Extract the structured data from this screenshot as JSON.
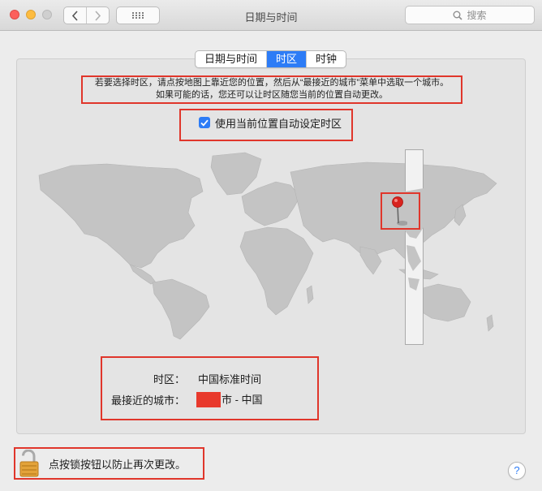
{
  "window": {
    "title": "日期与时间",
    "search_placeholder": "搜索"
  },
  "tabs": [
    {
      "label": "日期与时间",
      "active": false
    },
    {
      "label": "时区",
      "active": true
    },
    {
      "label": "时钟",
      "active": false
    }
  ],
  "instruction": {
    "line1": "若要选择时区，请点按地图上靠近您的位置，然后从“最接近的城市”菜单中选取一个城市。",
    "line2": "如果可能的话，您还可以让时区随您当前的位置自动更改。"
  },
  "auto_timezone": {
    "label": "使用当前位置自动设定时区",
    "checked": true
  },
  "timezone_info": {
    "timezone_label": "时区：",
    "timezone_value": "中国标准时间",
    "city_label": "最接近的城市：",
    "city_value": "市 - 中国"
  },
  "lock": {
    "label": "点按锁按钮以防止再次更改。"
  },
  "help_label": "?",
  "colors": {
    "accent": "#2d7cf6",
    "highlight_box": "#e0362b",
    "land": "#c2c2c2",
    "pin": "#d8231f"
  }
}
